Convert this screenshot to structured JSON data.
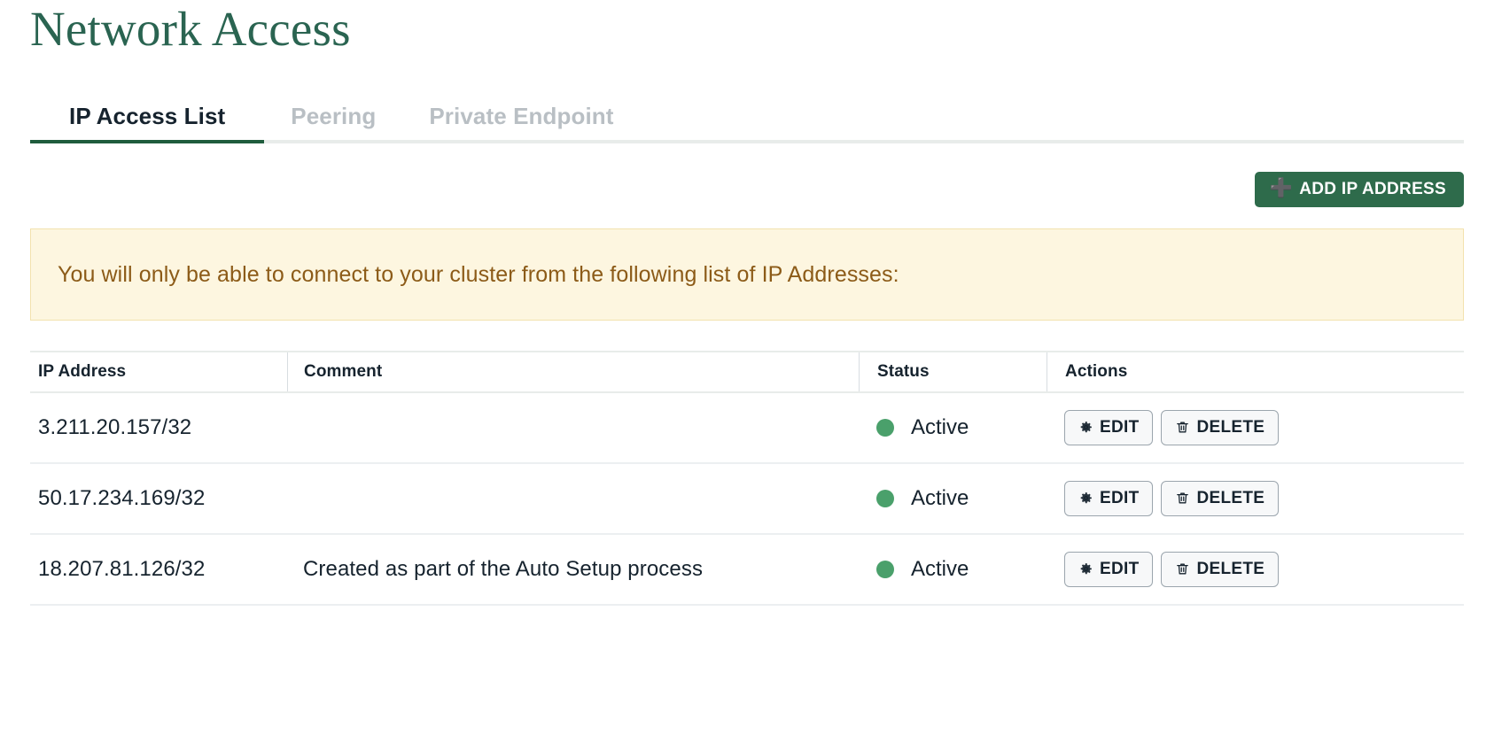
{
  "page": {
    "title": "Network Access"
  },
  "tabs": [
    {
      "label": "IP Access List",
      "active": true
    },
    {
      "label": "Peering",
      "active": false
    },
    {
      "label": "Private Endpoint",
      "active": false
    }
  ],
  "toolbar": {
    "add_ip_label": "ADD IP ADDRESS",
    "add_ip_icon": "plus-icon",
    "add_ip_plus": "✛"
  },
  "banner": {
    "text": "You will only be able to connect to your cluster from the following list of IP Addresses:",
    "background_color": "#fdf6e0",
    "border_color": "#f2e2ae",
    "text_color": "#8c5b18"
  },
  "table": {
    "columns": [
      "IP Address",
      "Comment",
      "Status",
      "Actions"
    ],
    "rows": [
      {
        "ip": "3.211.20.157/32",
        "comment": "",
        "status": "Active",
        "status_color": "#4aa06b",
        "edit_label": "EDIT",
        "delete_label": "DELETE"
      },
      {
        "ip": "50.17.234.169/32",
        "comment": "",
        "status": "Active",
        "status_color": "#4aa06b",
        "edit_label": "EDIT",
        "delete_label": "DELETE"
      },
      {
        "ip": "18.207.81.126/32",
        "comment": "Created as part of the Auto Setup process",
        "status": "Active",
        "status_color": "#4aa06b",
        "edit_label": "EDIT",
        "delete_label": "DELETE"
      }
    ]
  },
  "colors": {
    "title_green": "#2a6451",
    "accent_green": "#2e6b4b",
    "tab_active_underline": "#1f5c3d",
    "tab_inactive_text": "#b9bfc4",
    "text_dark": "#16232e"
  }
}
